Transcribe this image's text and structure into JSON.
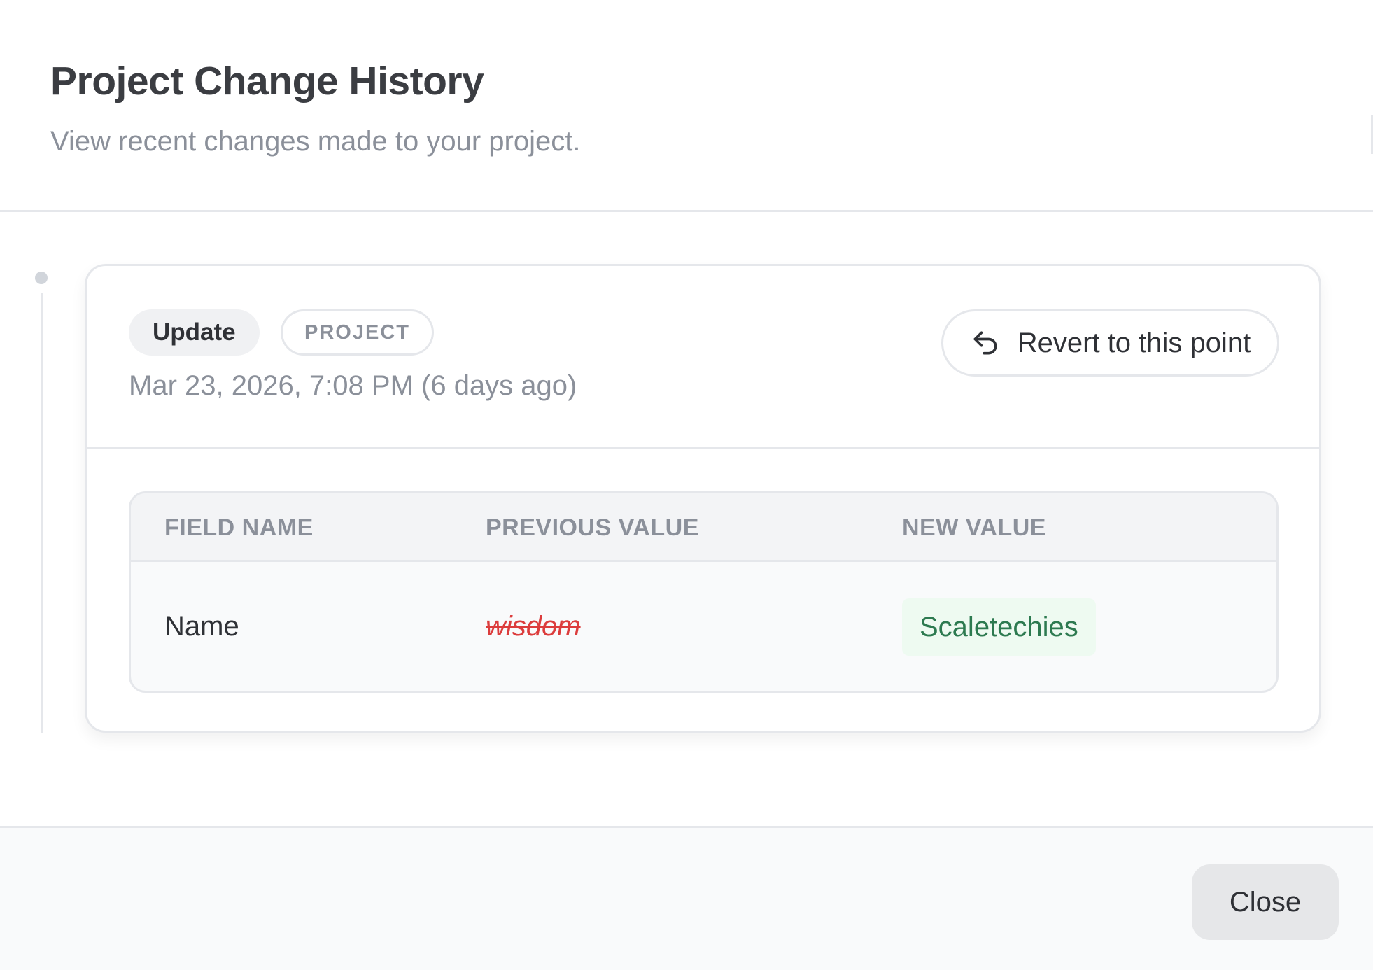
{
  "dialog": {
    "title": "Project Change History",
    "subtitle": "View recent changes made to your project."
  },
  "entry": {
    "action_badge": "Update",
    "entity_badge": "PROJECT",
    "timestamp": "Mar 23, 2026, 7:08 PM (6 days ago)",
    "revert_label": "Revert to this point",
    "revert_icon": "undo-icon"
  },
  "changes_table": {
    "headers": [
      "FIELD NAME",
      "PREVIOUS VALUE",
      "NEW VALUE"
    ],
    "rows": [
      {
        "field": "Name",
        "previous": "wisdom",
        "new": "Scaletechies"
      }
    ]
  },
  "footer": {
    "close_label": "Close"
  },
  "colors": {
    "previous_value": "#dc3c3c",
    "new_value": "#2d7a50",
    "new_value_bg": "#eefaf1"
  }
}
